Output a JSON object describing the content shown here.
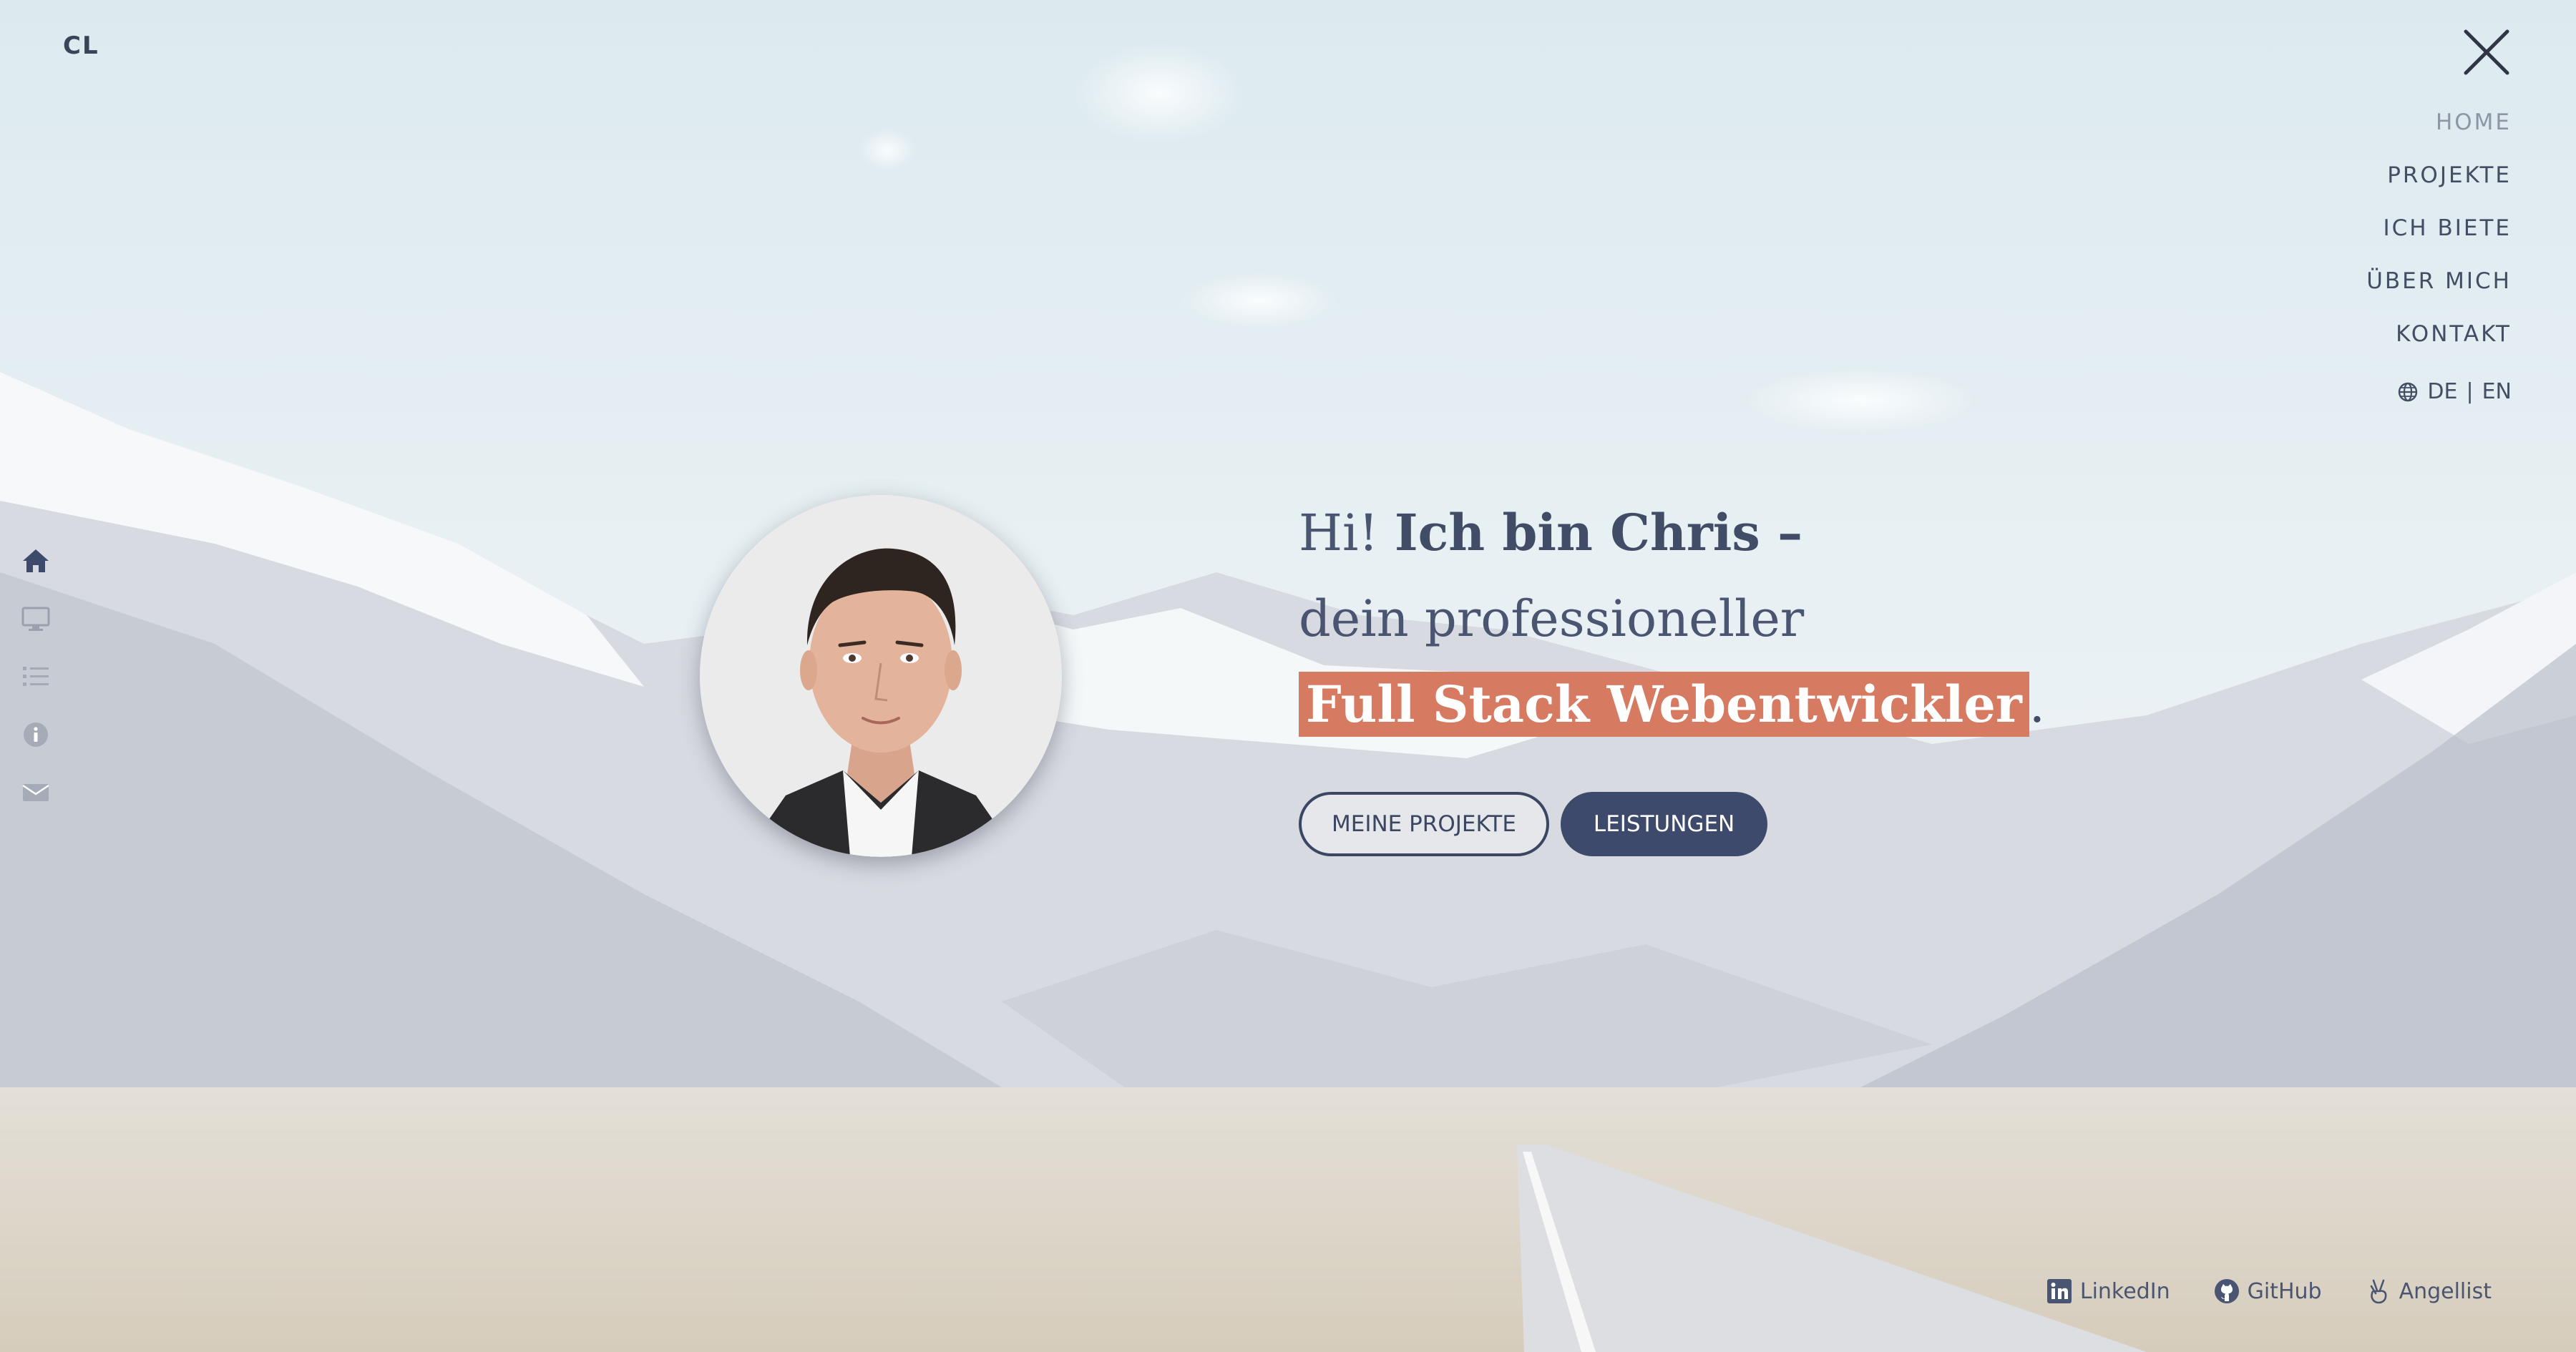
{
  "brand": {
    "logo": "CL"
  },
  "nav": {
    "items": [
      {
        "label": "HOME",
        "active": true
      },
      {
        "label": "PROJEKTE",
        "active": false
      },
      {
        "label": "ICH BIETE",
        "active": false
      },
      {
        "label": "ÜBER MICH",
        "active": false
      },
      {
        "label": "KONTAKT",
        "active": false
      }
    ],
    "language": {
      "de": "DE",
      "separator": "|",
      "en": "EN",
      "icon": "globe-icon"
    }
  },
  "sidenav": {
    "icons": [
      "home-icon",
      "desktop-icon",
      "list-icon",
      "info-icon",
      "envelope-icon"
    ]
  },
  "hero": {
    "greeting": "Hi!",
    "name": "Ich bin Chris –",
    "line2": "dein professioneller",
    "role": "Full Stack Webentwickler",
    "period": "."
  },
  "buttons": {
    "projects": "MEINE PROJEKTE",
    "services": "LEISTUNGEN"
  },
  "social": {
    "linkedin": "LinkedIn",
    "github": "GitHub",
    "angellist": "Angellist"
  },
  "colors": {
    "primary": "#3d4a6b",
    "accent": "#d77a62",
    "text": "#414d66"
  }
}
